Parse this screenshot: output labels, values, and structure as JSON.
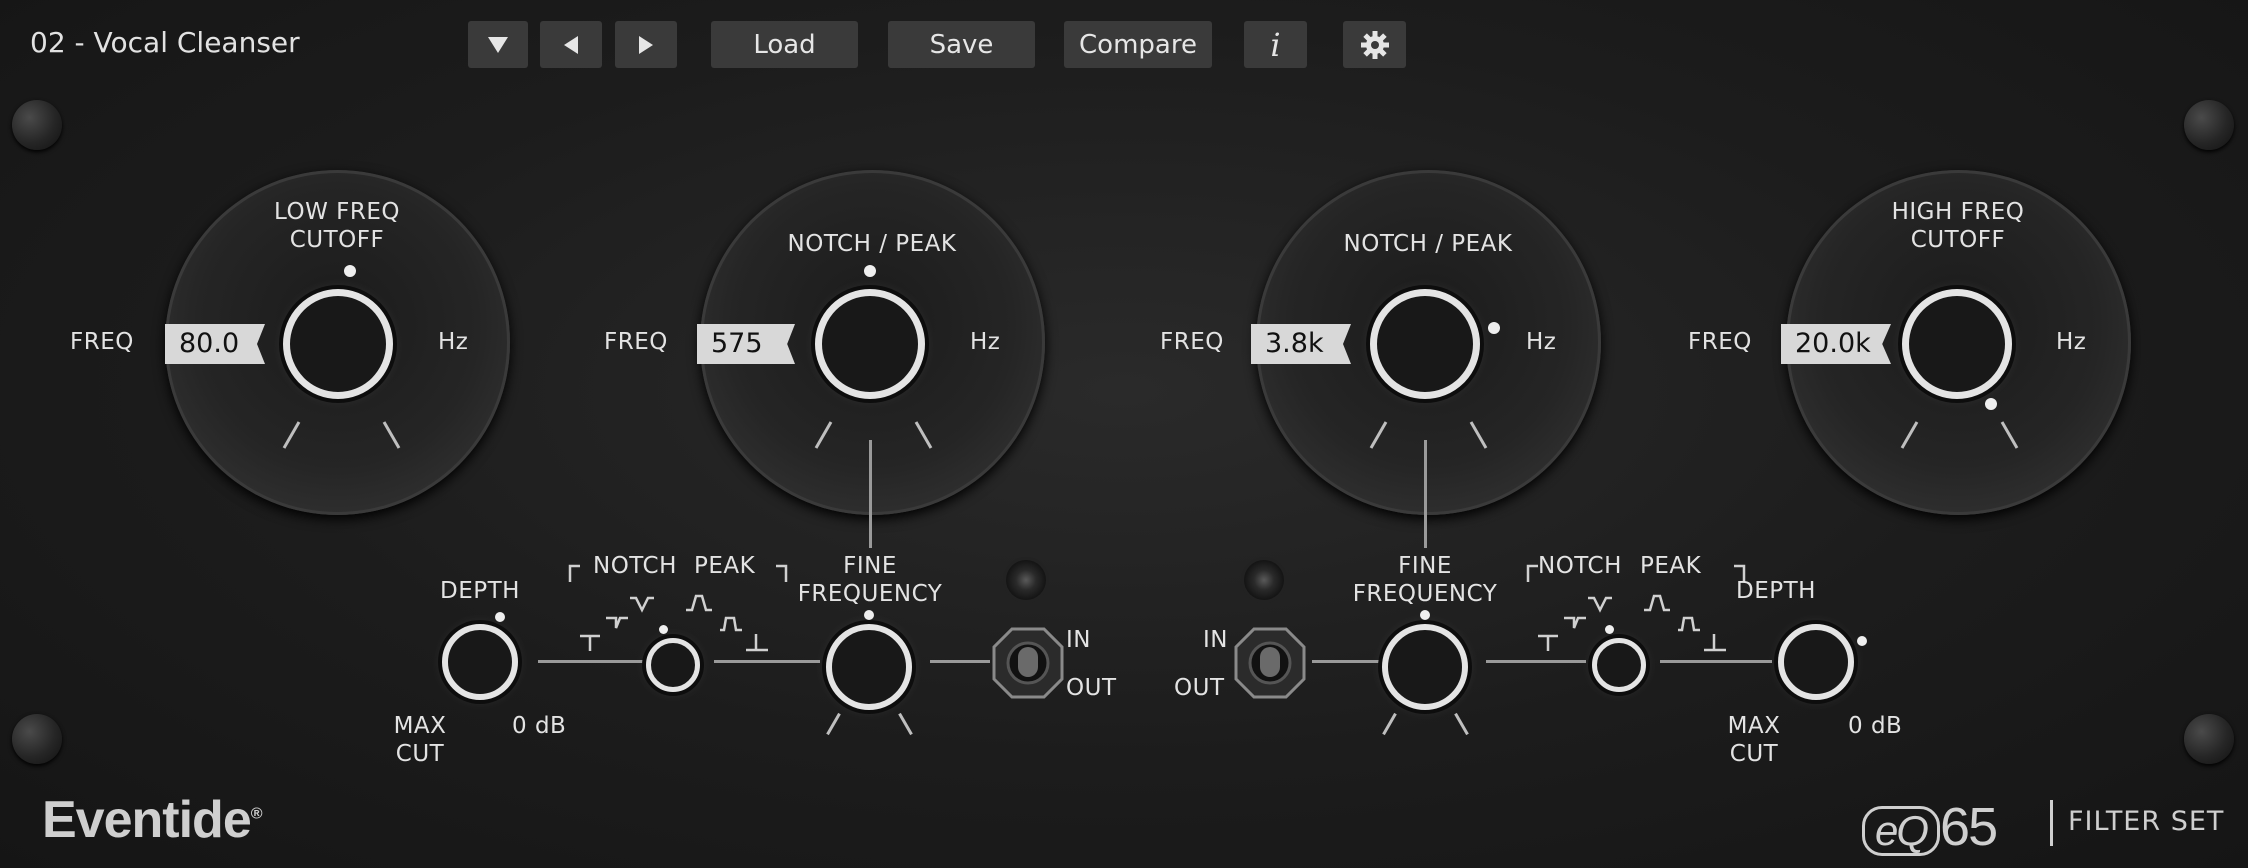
{
  "preset": {
    "name": "02 - Vocal Cleanser"
  },
  "toolbar": {
    "load_label": "Load",
    "save_label": "Save",
    "compare_label": "Compare",
    "info_label": "i"
  },
  "bands": {
    "low_cut": {
      "title_line1": "LOW FREQ",
      "title_line2": "CUTOFF",
      "freq_label": "FREQ",
      "value": "80.0",
      "unit": "Hz"
    },
    "notch1": {
      "title": "NOTCH / PEAK",
      "freq_label": "FREQ",
      "value": "575",
      "unit": "Hz"
    },
    "notch2": {
      "title": "NOTCH / PEAK",
      "freq_label": "FREQ",
      "value": "3.8k",
      "unit": "Hz"
    },
    "high_cut": {
      "title_line1": "HIGH FREQ",
      "title_line2": "CUTOFF",
      "freq_label": "FREQ",
      "value": "20.0k",
      "unit": "Hz"
    }
  },
  "section1": {
    "depth_label": "DEPTH",
    "max_cut_line1": "MAX",
    "max_cut_line2": "CUT",
    "zero_db": "0 dB",
    "notch_label": "NOTCH",
    "peak_label": "PEAK",
    "fine_line1": "FINE",
    "fine_line2": "FREQUENCY",
    "in_label": "IN",
    "out_label": "OUT"
  },
  "section2": {
    "depth_label": "DEPTH",
    "max_cut_line1": "MAX",
    "max_cut_line2": "CUT",
    "zero_db": "0 dB",
    "notch_label": "NOTCH",
    "peak_label": "PEAK",
    "fine_line1": "FINE",
    "fine_line2": "FREQUENCY",
    "in_label": "IN",
    "out_label": "OUT"
  },
  "footer": {
    "brand": "Eventide",
    "brand_mark": "®",
    "product_eq": "eQ",
    "product_num": "65",
    "product_suffix": "FILTER SET"
  },
  "icons": {
    "dropdown": "triangle-down-icon",
    "prev": "triangle-left-icon",
    "next": "triangle-right-icon",
    "settings": "gear-icon"
  },
  "colors": {
    "panel": "#1c1c1c",
    "button": "#3a3a3a",
    "knob_ring": "#e4e4e4",
    "freq_box": "#d8d8d8"
  }
}
